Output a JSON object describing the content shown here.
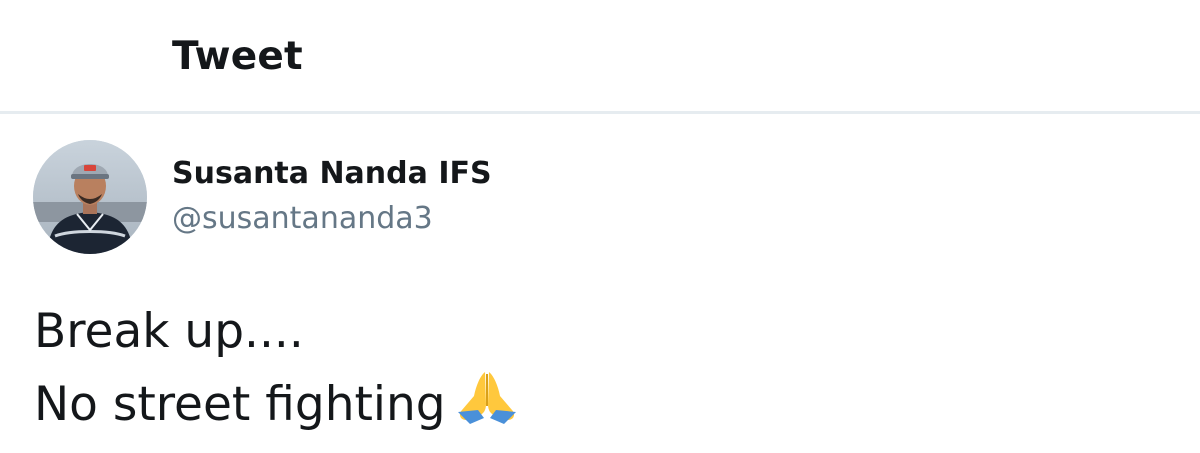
{
  "header": {
    "title": "Tweet"
  },
  "tweet": {
    "author": {
      "name": "Susanta Nanda IFS",
      "handle": "@susantananda3",
      "avatar": "profile-photo"
    },
    "lines": [
      "Break up....",
      "No street fighting"
    ],
    "emoji": "folded-hands-icon"
  },
  "colors": {
    "text": "#14171a",
    "handle": "#657786",
    "divider": "#e6ecf0"
  }
}
